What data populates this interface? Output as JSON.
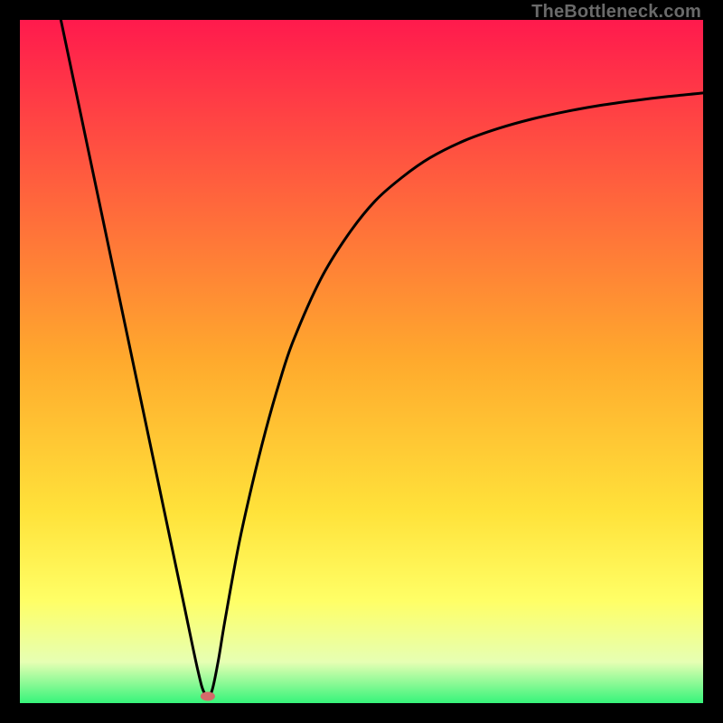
{
  "watermark": "TheBottleneck.com",
  "chart_data": {
    "type": "line",
    "title": "",
    "xlabel": "",
    "ylabel": "",
    "xlim": [
      0,
      100
    ],
    "ylim": [
      0,
      100
    ],
    "legend": false,
    "grid": false,
    "background_gradient_stops": [
      {
        "pos": 0.0,
        "color": "#ff1a4d"
      },
      {
        "pos": 0.5,
        "color": "#ffaa2d"
      },
      {
        "pos": 0.72,
        "color": "#ffe23a"
      },
      {
        "pos": 0.85,
        "color": "#ffff66"
      },
      {
        "pos": 0.94,
        "color": "#e6ffb3"
      },
      {
        "pos": 1.0,
        "color": "#36f47a"
      }
    ],
    "series": [
      {
        "name": "bottleneck-curve",
        "color": "#000000",
        "x": [
          6,
          8,
          10,
          12,
          14,
          16,
          18,
          20,
          22,
          24,
          26,
          27,
          28,
          29,
          30,
          32,
          34,
          36,
          38,
          40,
          44,
          48,
          52,
          56,
          60,
          65,
          70,
          75,
          80,
          85,
          90,
          95,
          100
        ],
        "y": [
          100,
          90.5,
          81,
          71.5,
          62,
          52.5,
          43,
          33.5,
          24,
          14.5,
          5,
          1.5,
          1.5,
          6,
          12,
          23,
          32,
          40,
          47,
          53,
          62,
          68.5,
          73.5,
          77,
          79.8,
          82.3,
          84.1,
          85.5,
          86.6,
          87.5,
          88.2,
          88.8,
          89.3
        ]
      }
    ],
    "marker": {
      "name": "optimal-point",
      "x": 27.5,
      "y": 1.0,
      "color": "#d46a6a",
      "rx": 8,
      "ry": 5
    }
  }
}
